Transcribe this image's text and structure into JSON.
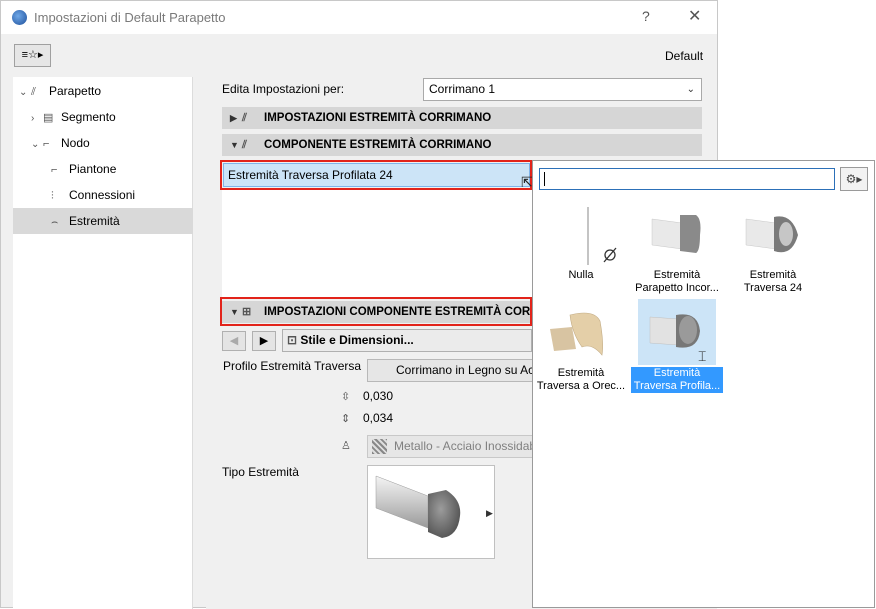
{
  "window": {
    "title": "Impostazioni di Default Parapetto",
    "help_label": "?",
    "close_label": "✕",
    "favorites_label": "≡☆▸",
    "default_label": "Default"
  },
  "tree": {
    "items": [
      {
        "label": "Parapetto",
        "arrow": "⌄",
        "icon": "⫽"
      },
      {
        "label": "Segmento",
        "arrow": "›",
        "icon": "▤"
      },
      {
        "label": "Nodo",
        "arrow": "⌄",
        "icon": "⌐"
      },
      {
        "label": "Piantone",
        "arrow": "",
        "icon": "⌐"
      },
      {
        "label": "Connessioni",
        "arrow": "",
        "icon": "⫶"
      },
      {
        "label": "Estremità",
        "arrow": "",
        "icon": "⌢"
      }
    ],
    "selected_index": 5
  },
  "edit": {
    "label": "Edita Impostazioni per:",
    "value": "Corrimano 1",
    "chevron": "⌄"
  },
  "sections": {
    "impostazioni_estremita": {
      "label": "IMPOSTAZIONI ESTREMITÀ CORRIMANO",
      "tri": "▶",
      "icon": "⫽"
    },
    "componente_estremita": {
      "label": "COMPONENTE ESTREMITÀ CORRIMANO",
      "tri": "▼",
      "icon": "⫽"
    },
    "impostazioni_componente": {
      "label": "IMPOSTAZIONI COMPONENTE ESTREMITÀ CORRIMANO",
      "tri": "▼",
      "icon": "⊞"
    }
  },
  "component_select": {
    "value": "Estremità Traversa Profilata 24"
  },
  "nav": {
    "prev_label": "◀",
    "next_label": "▶",
    "style_label": "Stile e Dimensioni..."
  },
  "profile": {
    "label": "Profilo Estremità Traversa",
    "value": "Corrimano in Legno su Acciaio"
  },
  "dimensions": [
    {
      "icon": "⇳",
      "value": "0,030"
    },
    {
      "icon": "⇕",
      "value": "0,034"
    }
  ],
  "material": {
    "icon": "♙",
    "value": "Metallo - Acciaio Inossidabile"
  },
  "tipo": {
    "label": "Tipo Estremità",
    "arrow": "▶"
  },
  "popup": {
    "search_value": "",
    "gear_label": "⚙▸",
    "items": [
      {
        "name": "Nulla",
        "selected": false
      },
      {
        "name": "Estremità Parapetto Incor...",
        "selected": false
      },
      {
        "name": "Estremità Traversa 24",
        "selected": false
      },
      {
        "name": "Estremità Traversa a Orec...",
        "selected": false
      },
      {
        "name": "Estremità Traversa Profila...",
        "selected": true
      }
    ]
  },
  "colors": {
    "highlight_red": "#e2231a",
    "selection_blue": "#3399ff",
    "selection_light": "#cce4f7"
  }
}
